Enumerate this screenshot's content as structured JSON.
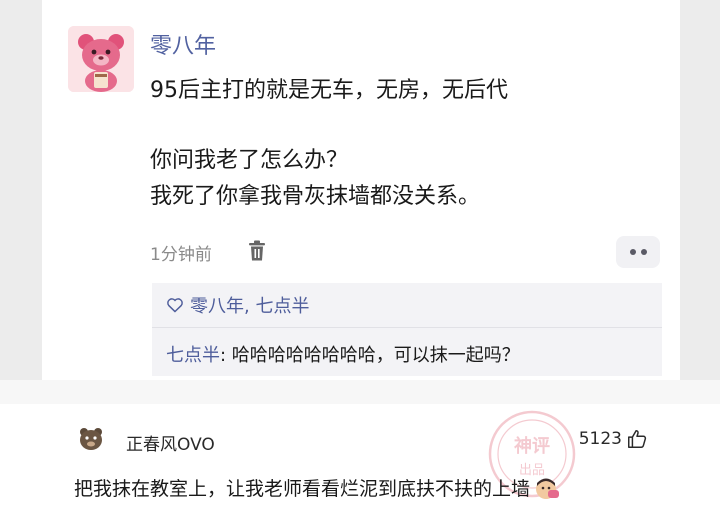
{
  "post": {
    "author": "零八年",
    "lines": [
      "95后主打的就是无车，无房，无后代",
      "你问我老了怎么办？",
      "我死了你拿我骨灰抹墙都没关系。"
    ],
    "time": "1分钟前"
  },
  "likes": {
    "names": "零八年, 七点半"
  },
  "reply": {
    "name": "七点半",
    "sep": ": ",
    "text": "哈哈哈哈哈哈哈哈，可以抹一起吗？"
  },
  "comment": {
    "username": "正春风OVO",
    "like_count": "5123",
    "text": "把我抹在教室上，让我老师看看烂泥到底扶不扶的上墙"
  },
  "watermark": {
    "text_top": "神评",
    "text_bottom": "出品"
  },
  "colors": {
    "author": "#5161a0",
    "watermark": "#e06a7b"
  }
}
